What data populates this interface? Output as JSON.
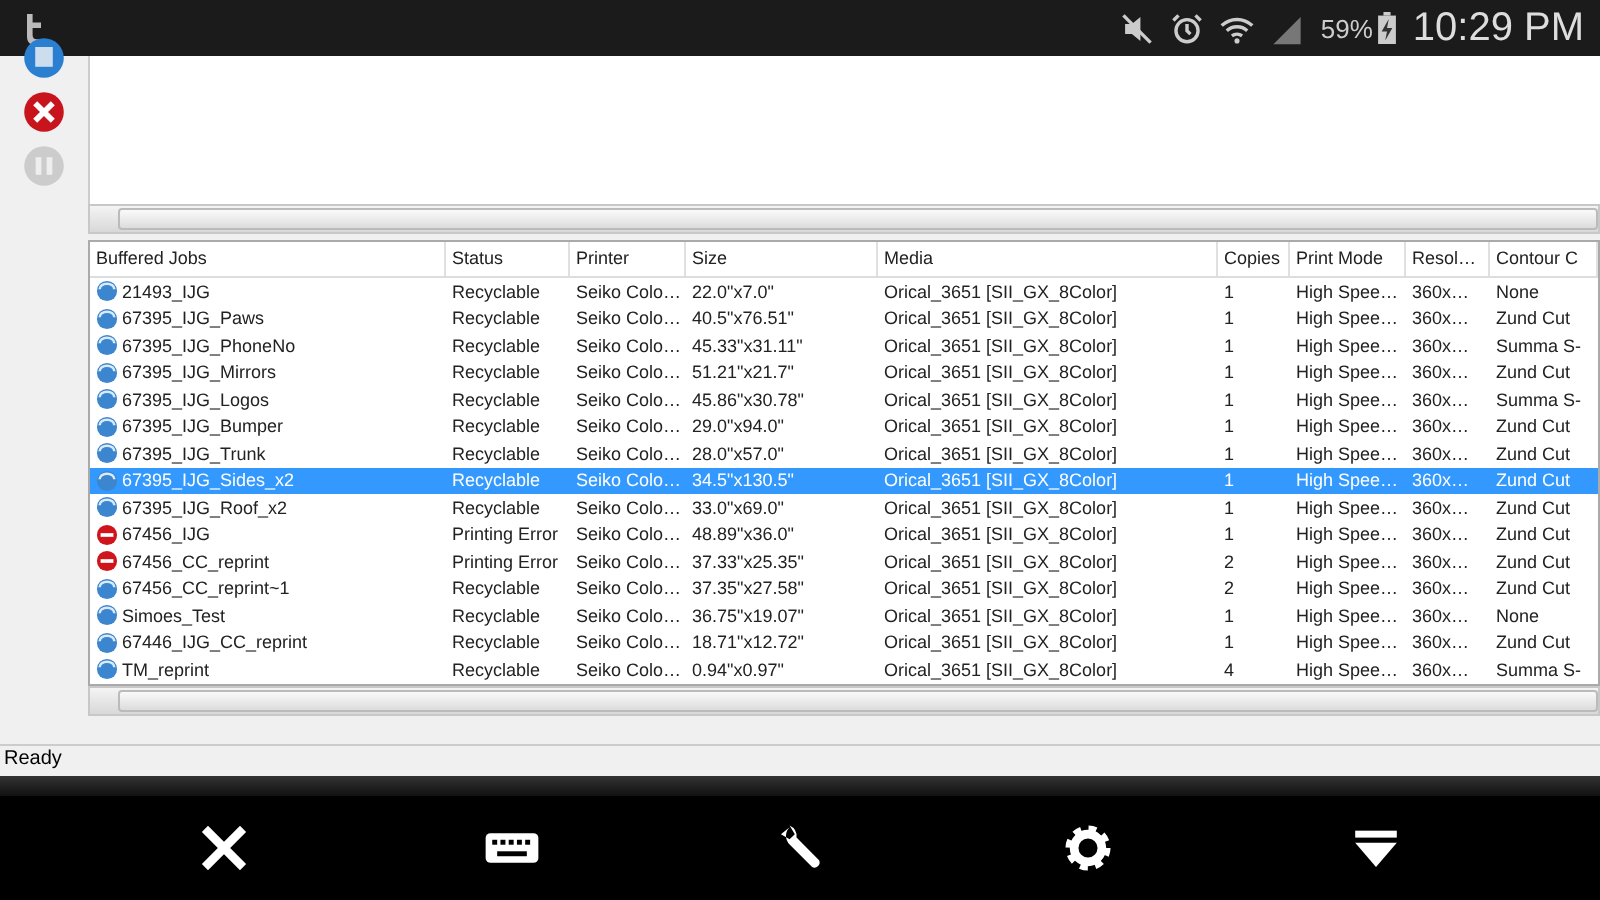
{
  "status_bar": {
    "battery": "59%",
    "time": "10:29 PM"
  },
  "table": {
    "columns": [
      "Buffered Jobs",
      "Status",
      "Printer",
      "Size",
      "Media",
      "Copies",
      "Print Mode",
      "Resol…",
      "Contour C"
    ],
    "rows": [
      {
        "kind": "ok",
        "selected": false,
        "cells": [
          "21493_IJG",
          "Recyclable",
          "Seiko Colo…",
          "22.0\"x7.0\"",
          "Orical_3651 [SII_GX_8Color]",
          "1",
          "High Spee…",
          "360x…",
          "None"
        ]
      },
      {
        "kind": "ok",
        "selected": false,
        "cells": [
          "67395_IJG_Paws",
          "Recyclable",
          "Seiko Colo…",
          "40.5\"x76.51\"",
          "Orical_3651 [SII_GX_8Color]",
          "1",
          "High Spee…",
          "360x…",
          "Zund Cut"
        ]
      },
      {
        "kind": "ok",
        "selected": false,
        "cells": [
          "67395_IJG_PhoneNo",
          "Recyclable",
          "Seiko Colo…",
          "45.33\"x31.11\"",
          "Orical_3651 [SII_GX_8Color]",
          "1",
          "High Spee…",
          "360x…",
          "Summa S-"
        ]
      },
      {
        "kind": "ok",
        "selected": false,
        "cells": [
          "67395_IJG_Mirrors",
          "Recyclable",
          "Seiko Colo…",
          "51.21\"x21.7\"",
          "Orical_3651 [SII_GX_8Color]",
          "1",
          "High Spee…",
          "360x…",
          "Zund Cut"
        ]
      },
      {
        "kind": "ok",
        "selected": false,
        "cells": [
          "67395_IJG_Logos",
          "Recyclable",
          "Seiko Colo…",
          "45.86\"x30.78\"",
          "Orical_3651 [SII_GX_8Color]",
          "1",
          "High Spee…",
          "360x…",
          "Summa S-"
        ]
      },
      {
        "kind": "ok",
        "selected": false,
        "cells": [
          "67395_IJG_Bumper",
          "Recyclable",
          "Seiko Colo…",
          "29.0\"x94.0\"",
          "Orical_3651 [SII_GX_8Color]",
          "1",
          "High Spee…",
          "360x…",
          "Zund Cut"
        ]
      },
      {
        "kind": "ok",
        "selected": false,
        "cells": [
          "67395_IJG_Trunk",
          "Recyclable",
          "Seiko Colo…",
          "28.0\"x57.0\"",
          "Orical_3651 [SII_GX_8Color]",
          "1",
          "High Spee…",
          "360x…",
          "Zund Cut"
        ]
      },
      {
        "kind": "ok",
        "selected": true,
        "cells": [
          "67395_IJG_Sides_x2",
          "Recyclable",
          "Seiko Colo…",
          "34.5\"x130.5\"",
          "Orical_3651 [SII_GX_8Color]",
          "1",
          "High Spee…",
          "360x…",
          "Zund Cut"
        ]
      },
      {
        "kind": "ok",
        "selected": false,
        "cells": [
          "67395_IJG_Roof_x2",
          "Recyclable",
          "Seiko Colo…",
          "33.0\"x69.0\"",
          "Orical_3651 [SII_GX_8Color]",
          "1",
          "High Spee…",
          "360x…",
          "Zund Cut"
        ]
      },
      {
        "kind": "error",
        "selected": false,
        "cells": [
          "67456_IJG",
          "Printing Error",
          "Seiko Colo…",
          "48.89\"x36.0\"",
          "Orical_3651 [SII_GX_8Color]",
          "1",
          "High Spee…",
          "360x…",
          "Zund Cut"
        ]
      },
      {
        "kind": "error",
        "selected": false,
        "cells": [
          "67456_CC_reprint",
          "Printing Error",
          "Seiko Colo…",
          "37.33\"x25.35\"",
          "Orical_3651 [SII_GX_8Color]",
          "2",
          "High Spee…",
          "360x…",
          "Zund Cut"
        ]
      },
      {
        "kind": "ok",
        "selected": false,
        "cells": [
          "67456_CC_reprint~1",
          "Recyclable",
          "Seiko Colo…",
          "37.35\"x27.58\"",
          "Orical_3651 [SII_GX_8Color]",
          "2",
          "High Spee…",
          "360x…",
          "Zund Cut"
        ]
      },
      {
        "kind": "ok",
        "selected": false,
        "cells": [
          "Simoes_Test",
          "Recyclable",
          "Seiko Colo…",
          "36.75\"x19.07\"",
          "Orical_3651 [SII_GX_8Color]",
          "1",
          "High Spee…",
          "360x…",
          "None"
        ]
      },
      {
        "kind": "ok",
        "selected": false,
        "cells": [
          "67446_IJG_CC_reprint",
          "Recyclable",
          "Seiko Colo…",
          "18.71\"x12.72\"",
          "Orical_3651 [SII_GX_8Color]",
          "1",
          "High Spee…",
          "360x…",
          "Zund Cut"
        ]
      },
      {
        "kind": "ok",
        "selected": false,
        "cells": [
          "TM_reprint",
          "Recyclable",
          "Seiko Colo…",
          "0.94\"x0.97\"",
          "Orical_3651 [SII_GX_8Color]",
          "4",
          "High Spee…",
          "360x…",
          "Summa S-"
        ]
      }
    ]
  },
  "app_status": "Ready"
}
